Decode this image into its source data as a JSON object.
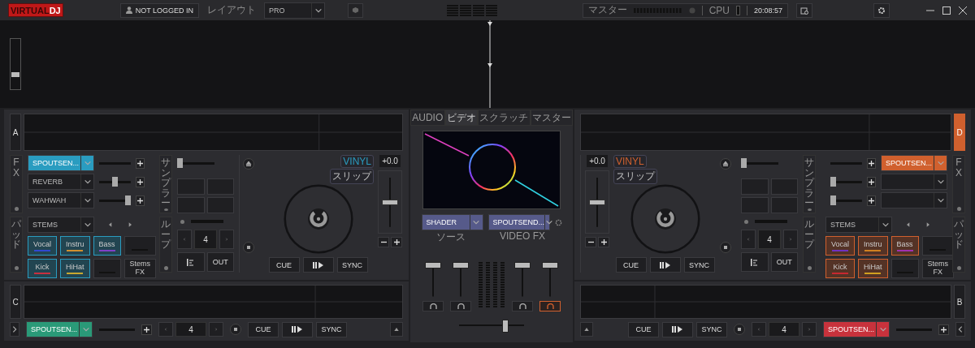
{
  "topbar": {
    "logo_left": "VIRTUAL",
    "logo_right": "DJ",
    "login": "NOT LOGGED IN",
    "layout_label": "レイアウト",
    "layout_value": "PRO",
    "master_label": "マスター",
    "cpu_label": "CPU",
    "clock": "20:08:57"
  },
  "overview": {
    "zoom": {
      "level": 0.27
    }
  },
  "decks": [
    {
      "letter": "A",
      "color": "#2a9cc0",
      "selected": false,
      "labels": {
        "fx": "FX",
        "sampler": "サンプラー",
        "pads": "パッド",
        "loop": "ループ"
      },
      "fx": [
        {
          "name": "SPOUTSEN...",
          "active": true
        },
        {
          "name": "REVERB",
          "active": false,
          "level": 0.5
        },
        {
          "name": "WAHWAH",
          "active": false,
          "level": 1
        }
      ],
      "sampler": {
        "level": 0
      },
      "stems_mode": "STEMS",
      "pads": [
        {
          "kind": "stem",
          "label": "Vocal",
          "color": "#3048d0",
          "active": true
        },
        {
          "kind": "stem",
          "label": "Instru",
          "color": "#d09030",
          "active": true
        },
        {
          "kind": "stem",
          "label": "Bass",
          "color": "#8040c8",
          "active": true
        },
        {
          "kind": "blank"
        },
        {
          "kind": "stem",
          "label": "Kick",
          "color": "#c83040",
          "active": true
        },
        {
          "kind": "stem",
          "label": "HiHat",
          "color": "#c8a830",
          "active": true
        },
        {
          "kind": "blank"
        },
        {
          "kind": "fx",
          "label": "Stems FX"
        }
      ],
      "loop": "4",
      "loop_out": "OUT",
      "pitch": "+0.0",
      "pitch_fader": {
        "level": 0.5
      },
      "vinyl": "VINYL",
      "slip": "スリップ",
      "cue": "CUE",
      "sync": "SYNC"
    },
    {
      "letter": "D",
      "color": "#d0602e",
      "selected": true,
      "labels": {
        "fx": "FX",
        "sampler": "サンプラー",
        "pads": "パッド",
        "loop": "ループ"
      },
      "fx": [
        {
          "name": "SPOUTSEN...",
          "active": true
        },
        {
          "active": false,
          "level": 0
        },
        {
          "active": false,
          "level": 0
        }
      ],
      "sampler": {
        "level": 0
      },
      "stems_mode": "STEMS",
      "pads": [
        {
          "kind": "stem",
          "label": "Vocal",
          "color": "#7030c0",
          "active": true
        },
        {
          "kind": "stem",
          "label": "Instru",
          "color": "#d08020",
          "active": true
        },
        {
          "kind": "stem",
          "label": "Bass",
          "color": "#a030b0",
          "active": true
        },
        {
          "kind": "blank"
        },
        {
          "kind": "stem",
          "label": "Kick",
          "color": "#c82830",
          "active": true
        },
        {
          "kind": "stem",
          "label": "HiHat",
          "color": "#d0a020",
          "active": true
        },
        {
          "kind": "blank"
        },
        {
          "kind": "fx",
          "label": "Stems FX"
        }
      ],
      "loop": "4",
      "loop_out": "OUT",
      "pitch": "+0.0",
      "pitch_fader": {
        "level": 0.5
      },
      "vinyl": "VINYL",
      "slip": "スリップ",
      "cue": "CUE",
      "sync": "SYNC"
    }
  ],
  "center": {
    "tabs": [
      {
        "label": "AUDIO",
        "selected": false
      },
      {
        "label": "ビデオ",
        "selected": true
      },
      {
        "label": "スクラッチ",
        "selected": false
      },
      {
        "label": "マスター",
        "selected": false
      }
    ],
    "source": {
      "value": "SHADER",
      "label": "ソース"
    },
    "video_fx": {
      "value": "SPOUTSEND...",
      "label": "VIDEO FX"
    },
    "channels": [
      {
        "level": 1,
        "cue": false
      },
      {
        "level": 1,
        "cue": false
      },
      {
        "level": 1,
        "cue": false
      },
      {
        "level": 1,
        "cue": true
      }
    ],
    "crossfader": {
      "level": 0.74
    }
  },
  "mini_decks": [
    {
      "letter": "C",
      "color": "#2a9a78",
      "fx": "SPOUTSEN...",
      "loop": "4",
      "cue": "CUE",
      "sync": "SYNC"
    },
    {
      "letter": "B",
      "color": "#c8323c",
      "fx": "SPOUTSEN...",
      "loop": "4",
      "cue": "CUE",
      "sync": "SYNC"
    }
  ]
}
